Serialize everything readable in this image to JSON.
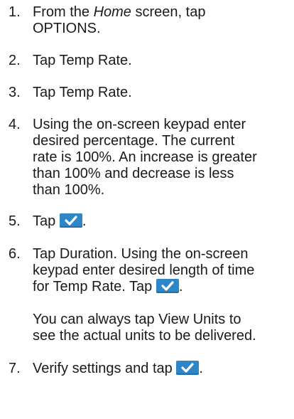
{
  "steps": [
    {
      "num": "1.",
      "parts": [
        "From the ",
        "Home",
        " screen, tap ",
        "OPTIONS",
        "."
      ]
    },
    {
      "num": "2.",
      "parts": [
        "Tap ",
        "Temp Rate",
        "."
      ]
    },
    {
      "num": "3.",
      "parts": [
        "Tap ",
        "Temp Rate",
        "."
      ]
    },
    {
      "num": "4.",
      "lines": [
        "Using the on-screen keypad enter",
        "desired percentage. The current",
        "rate is 100%. An increase is greater",
        "than 100% and decrease is less",
        "than 100%."
      ]
    },
    {
      "num": "5.",
      "parts": [
        "Tap ",
        "."
      ]
    },
    {
      "num": "6.",
      "line1": [
        "Tap ",
        "Duration",
        ". Using the on-screen"
      ],
      "line2": "keypad enter desired length of time",
      "line3": [
        "for Temp Rate. Tap ",
        "."
      ]
    },
    {
      "num": "7.",
      "parts": [
        "Verify settings and tap ",
        "."
      ]
    }
  ],
  "note": {
    "line1": [
      "You can always tap ",
      "View Units",
      " to"
    ],
    "line2": "see the actual units to be delivered."
  },
  "icons": {
    "confirm": "checkmark-icon",
    "confirm_color": "#2e86c8"
  }
}
